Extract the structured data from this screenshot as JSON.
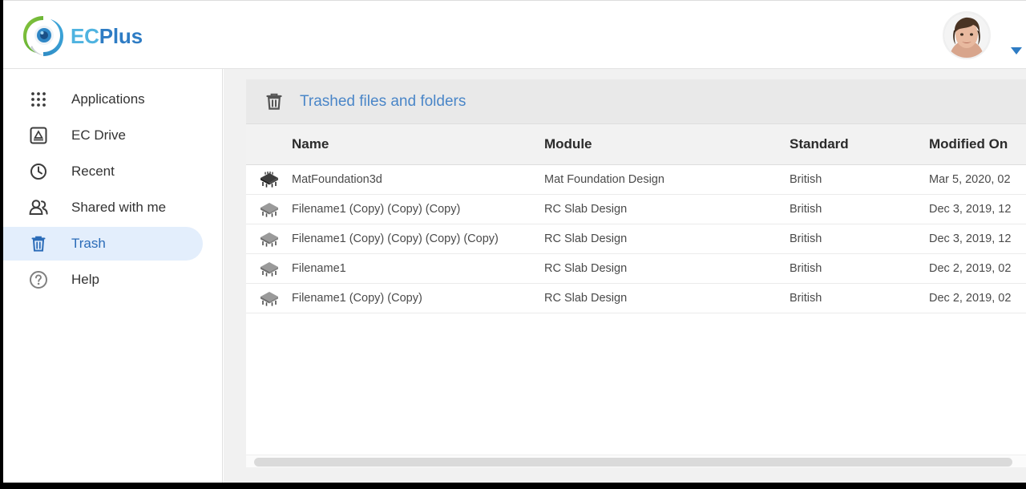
{
  "brand": {
    "logo_icon": "ecplus-eye-logo-icon",
    "name_part1": "EC",
    "name_part2": "Plus",
    "color_ec": "#4fb3e0",
    "color_plus": "#2e7cc4"
  },
  "topbar": {
    "avatar_icon": "user-avatar",
    "account_caret_icon": "chevron-down-icon",
    "caret_color": "#2e7cc4"
  },
  "sidebar": {
    "items": [
      {
        "label": "Applications",
        "icon": "grid-apps-icon",
        "active": false
      },
      {
        "label": "EC Drive",
        "icon": "drive-icon",
        "active": false
      },
      {
        "label": "Recent",
        "icon": "clock-icon",
        "active": false
      },
      {
        "label": "Shared with me",
        "icon": "people-icon",
        "active": false
      },
      {
        "label": "Trash",
        "icon": "trash-icon",
        "active": true
      },
      {
        "label": "Help",
        "icon": "question-mark-icon",
        "active": false
      }
    ],
    "active_bg": "#e3eefc",
    "active_fg": "#2b6cb8"
  },
  "panel": {
    "header_icon": "trash-icon",
    "title": "Trashed files and folders",
    "title_color": "#4a86c8",
    "columns": [
      "Name",
      "Module",
      "Standard",
      "Modified On"
    ],
    "rows": [
      {
        "icon": "mat-foundation-3d-icon",
        "name": "MatFoundation3d",
        "module": "Mat Foundation Design",
        "standard": "British",
        "modified_on": "Mar 5, 2020, 02"
      },
      {
        "icon": "rc-slab-icon",
        "name": "Filename1 (Copy) (Copy) (Copy)",
        "module": "RC Slab Design",
        "standard": "British",
        "modified_on": "Dec 3, 2019, 12"
      },
      {
        "icon": "rc-slab-icon",
        "name": "Filename1 (Copy) (Copy) (Copy) (Copy)",
        "module": "RC Slab Design",
        "standard": "British",
        "modified_on": "Dec 3, 2019, 12"
      },
      {
        "icon": "rc-slab-icon",
        "name": "Filename1",
        "module": "RC Slab Design",
        "standard": "British",
        "modified_on": "Dec 2, 2019, 02"
      },
      {
        "icon": "rc-slab-icon",
        "name": "Filename1 (Copy) (Copy)",
        "module": "RC Slab Design",
        "standard": "British",
        "modified_on": "Dec 2, 2019, 02"
      }
    ]
  },
  "scrollbar": {
    "orientation": "horizontal",
    "thumb_color": "#dadada"
  }
}
